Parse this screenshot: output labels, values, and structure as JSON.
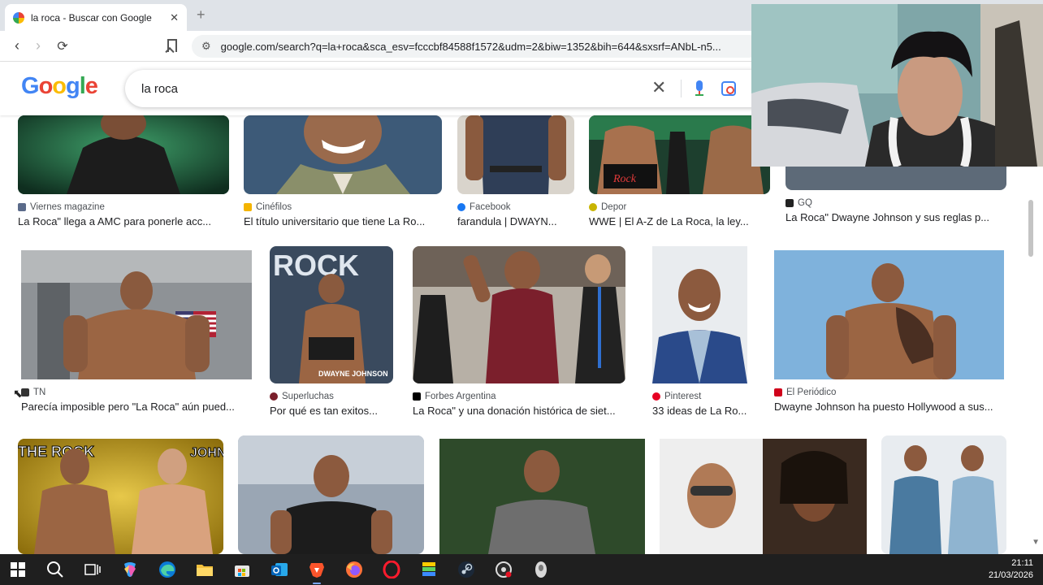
{
  "browser": {
    "tab": {
      "title": "la roca - Buscar con Google",
      "close": "✕"
    },
    "new_tab": "+",
    "address": "google.com/search?q=la+roca&sca_esv=fcccbf84588f1572&udm=2&biw=1352&bih=644&sxsrf=ANbL-n5..."
  },
  "google": {
    "logo": [
      "G",
      "o",
      "o",
      "g",
      "l",
      "e"
    ],
    "query": "la roca",
    "clear_icon": "✕"
  },
  "results": [
    {
      "source": "Viernes magazine",
      "caption": "La Roca\" llega a AMC para ponerle acc...",
      "favicon_color": "#5b6b8a"
    },
    {
      "source": "Cinéfilos",
      "caption": "El título universitario que tiene La Ro...",
      "favicon_color": "#f4b400"
    },
    {
      "source": "Facebook",
      "caption": "farandula | DWAYN...",
      "favicon_color": "#1877f2"
    },
    {
      "source": "Depor",
      "caption": "WWE | El A-Z de La Roca, la ley...",
      "favicon_color": "#c8b400"
    },
    {
      "source": "GQ",
      "caption": "La Roca\" Dwayne Johnson y sus reglas p...",
      "favicon_color": "#222222"
    },
    {
      "source": "TN",
      "caption": "Parecía imposible pero \"La Roca\" aún pued...",
      "favicon_color": "#333333"
    },
    {
      "source": "Superluchas",
      "caption": "Por qué es tan exitos...",
      "favicon_color": "#7a1f2b"
    },
    {
      "source": "Forbes Argentina",
      "caption": "La Roca\" y una donación histórica de siet...",
      "favicon_color": "#000000"
    },
    {
      "source": "Pinterest",
      "caption": "33 ideas de La Ro...",
      "favicon_color": "#e60023"
    },
    {
      "source": "El Periódico",
      "caption": "Dwayne Johnson ha puesto Hollywood a sus...",
      "favicon_color": "#d0021b"
    }
  ],
  "image_text": {
    "rock_cover": "ROCK",
    "dwayne": "DWAYNE JOHNSON",
    "the_rock": "THE ROCK",
    "john_cena": "JOHN CENA",
    "belt_rock": "Rock"
  },
  "taskbar": {
    "time": "21:11",
    "date": "21/03/2026"
  }
}
